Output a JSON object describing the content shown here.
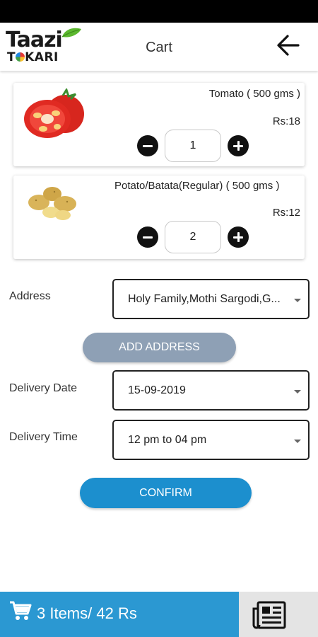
{
  "header": {
    "logo_line1": "Taazi",
    "logo_line2_pre": "T",
    "logo_line2_post": "KARI",
    "title": "Cart"
  },
  "cart": {
    "items": [
      {
        "name": "Tomato ( 500 gms )",
        "price": "Rs:18",
        "quantity": "1"
      },
      {
        "name": "Potato/Batata(Regular) ( 500 gms )",
        "price": "Rs:12",
        "quantity": "2"
      }
    ]
  },
  "form": {
    "address_label": "Address",
    "address_value": "Holy Family,Mothi Sargodi,G...",
    "add_address_label": "ADD ADDRESS",
    "date_label": "Delivery Date",
    "date_value": "15-09-2019",
    "time_label": "Delivery Time",
    "time_value": "12 pm to 04 pm",
    "confirm_label": "CONFIRM"
  },
  "footer": {
    "summary": "3 Items/ 42 Rs"
  },
  "icons": {
    "back": "arrow-left-icon",
    "cart": "shopping-cart-icon",
    "orders": "newspaper-icon",
    "minus": "minus-circle-icon",
    "plus": "plus-circle-icon"
  },
  "colors": {
    "primary_blue": "#2b98d2",
    "confirm_blue": "#1c8fce",
    "add_address_gray": "#8ea0b5",
    "orders_tab_bg": "#e4e4e4",
    "status_bar": "#000000"
  }
}
